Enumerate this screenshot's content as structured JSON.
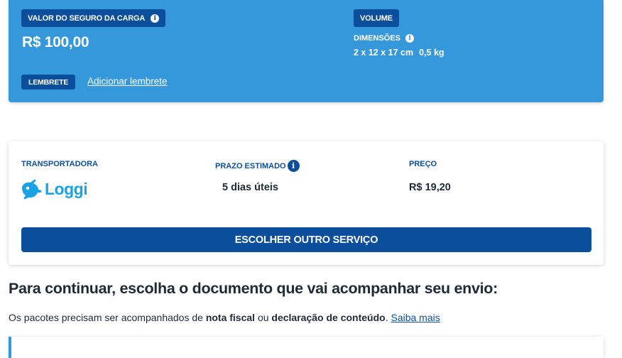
{
  "shipment": {
    "insurance_label": "VALOR DO SEGURO DA CARGA",
    "insurance_value": "R$ 100,00",
    "reminder_label": "LEMBRETE",
    "add_reminder_link": "Adicionar lembrete",
    "volume_label": "VOLUME",
    "dimensions_label": "DIMENSÕES",
    "dimensions_value": "2 x 12 x 17 cm",
    "weight_value": "0,5 kg"
  },
  "service": {
    "carrier_label": "TRANSPORTADORA",
    "carrier_name": "Loggi",
    "time_label": "PRAZO ESTIMADO",
    "time_value": "5 dias úteis",
    "price_label": "PREÇO",
    "price_value": "R$ 19,20",
    "choose_other_button": "ESCOLHER OUTRO SERVIÇO"
  },
  "document_section": {
    "heading": "Para continuar, escolha o documento que vai acompanhar seu envio:",
    "desc_prefix": "Os pacotes precisam ser acompanhados de ",
    "desc_bold1": "nota fiscal",
    "desc_mid": " ou ",
    "desc_bold2": "declaração de conteúdo",
    "desc_suffix": ". ",
    "learn_more_link": "Saiba mais"
  },
  "icons": {
    "info": "i",
    "carrier_logo": "loggi-rabbit-icon"
  },
  "colors": {
    "card_blue": "#3498db",
    "primary": "#0b4f9c",
    "logo_blue": "#1aa2e6"
  }
}
